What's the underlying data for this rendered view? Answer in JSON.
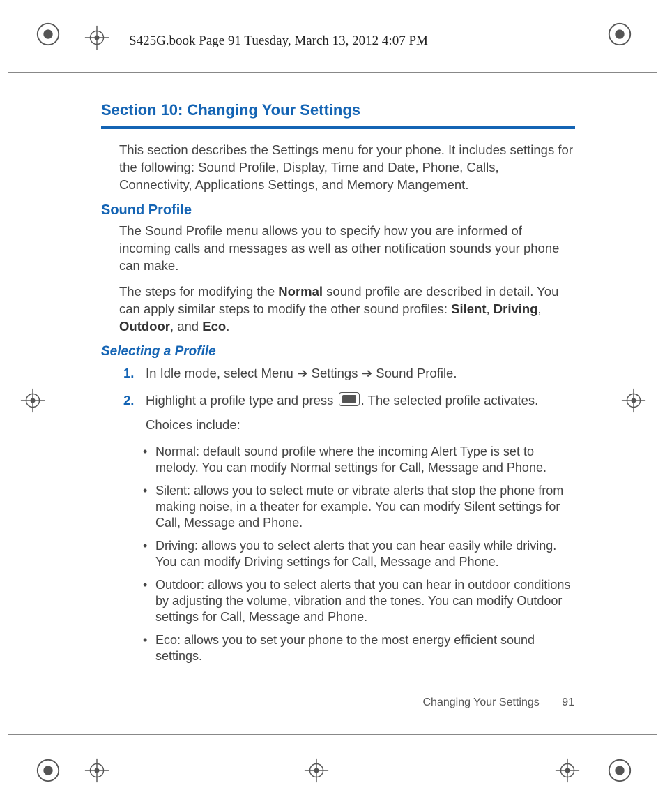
{
  "header_line": "S425G.book  Page 91  Tuesday, March 13, 2012  4:07 PM",
  "section_title": "Section 10: Changing Your Settings",
  "intro": "This section describes the Settings menu for your phone. It includes settings for the following: Sound Profile, Display, Time and Date, Phone, Calls, Connectivity, Applications Settings, and Memory Mangement.",
  "h2_sound_profile": "Sound Profile",
  "sound_para1": "The Sound Profile menu allows you to specify how you are informed of incoming calls and messages as well as other notification sounds your phone can make.",
  "sound_para2_pre": "The steps for modifying the ",
  "sound_para2_normal": "Normal",
  "sound_para2_mid": " sound profile are described in detail. You can apply similar steps to modify the other sound profiles: ",
  "sound_para2_silent": "Silent",
  "sound_para2_sep1": ", ",
  "sound_para2_driving": "Driving",
  "sound_para2_sep2": ", ",
  "sound_para2_outdoor": "Outdoor",
  "sound_para2_sep3": ", and ",
  "sound_para2_eco": "Eco",
  "sound_para2_end": ".",
  "h3_selecting": "Selecting a Profile",
  "step1_num": "1.",
  "step1_a": "In Idle mode, select ",
  "step1_menu": "Menu",
  "step1_arrow1": " ➔ ",
  "step1_settings": "Settings",
  "step1_arrow2": " ➔ ",
  "step1_sound": "Sound Profile",
  "step1_end": ".",
  "step2_num": "2.",
  "step2_a": "Highlight a profile type and press ",
  "step2_b": ". The selected profile activates.",
  "step2_choices": "Choices include:",
  "bullets": {
    "normal_label": "Normal",
    "normal_text": ": default sound profile where the incoming Alert Type is set to melody. You can modify Normal settings for Call, Message and Phone.",
    "silent_label": "Silent",
    "silent_text": ": allows you to select mute or vibrate alerts that stop the phone from making noise, in a theater for example. You can modify Silent settings for Call, Message and Phone.",
    "driving_label": "Driving",
    "driving_text": ": allows you to select alerts that you can hear easily while driving. You can modify Driving settings for Call, Message and Phone.",
    "outdoor_label": "Outdoor",
    "outdoor_text": ": allows you to select alerts that you can hear in outdoor conditions by adjusting the volume, vibration and the tones. You can modify Outdoor settings for Call, Message and Phone.",
    "eco_label": "Eco",
    "eco_text": ": allows you to set your phone to the most energy efficient sound settings."
  },
  "footer_text": "Changing Your Settings",
  "footer_page": "91"
}
